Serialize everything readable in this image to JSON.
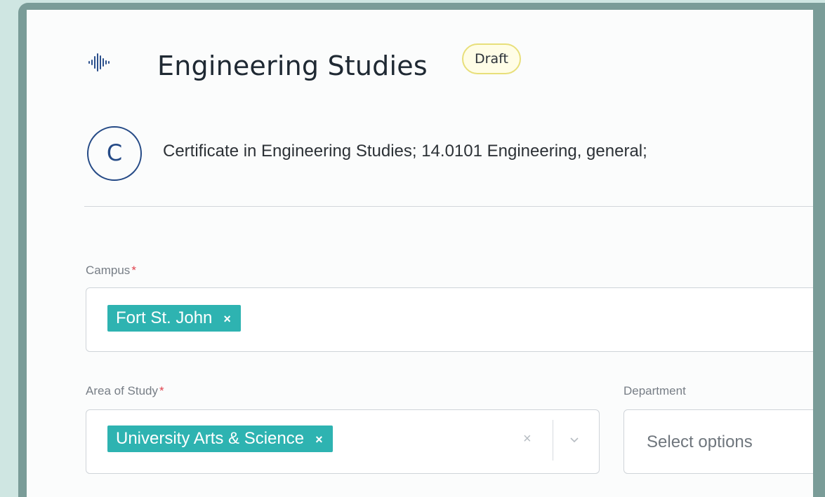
{
  "header": {
    "title": "Engineering Studies",
    "status_badge": "Draft",
    "logo_icon": "soundwave-logo-icon"
  },
  "credential": {
    "letter": "C",
    "description": "Certificate in Engineering Studies; 14.0101 Engineering, general;"
  },
  "form": {
    "campus": {
      "label": "Campus",
      "required_mark": "*",
      "selected": [
        "Fort St. John"
      ],
      "remove_glyph": "×"
    },
    "area_of_study": {
      "label": "Area of Study",
      "required_mark": "*",
      "selected": [
        "University Arts & Science"
      ],
      "remove_glyph": "×",
      "clear_glyph": "×"
    },
    "department": {
      "label": "Department",
      "placeholder": "Select options"
    }
  },
  "colors": {
    "accent_chip": "#2eb3b1",
    "badge_border": "#e8df7a",
    "credential_blue": "#254a86",
    "frame": "#7a9c98",
    "background": "#cfe6e2",
    "required": "#e0424d"
  }
}
